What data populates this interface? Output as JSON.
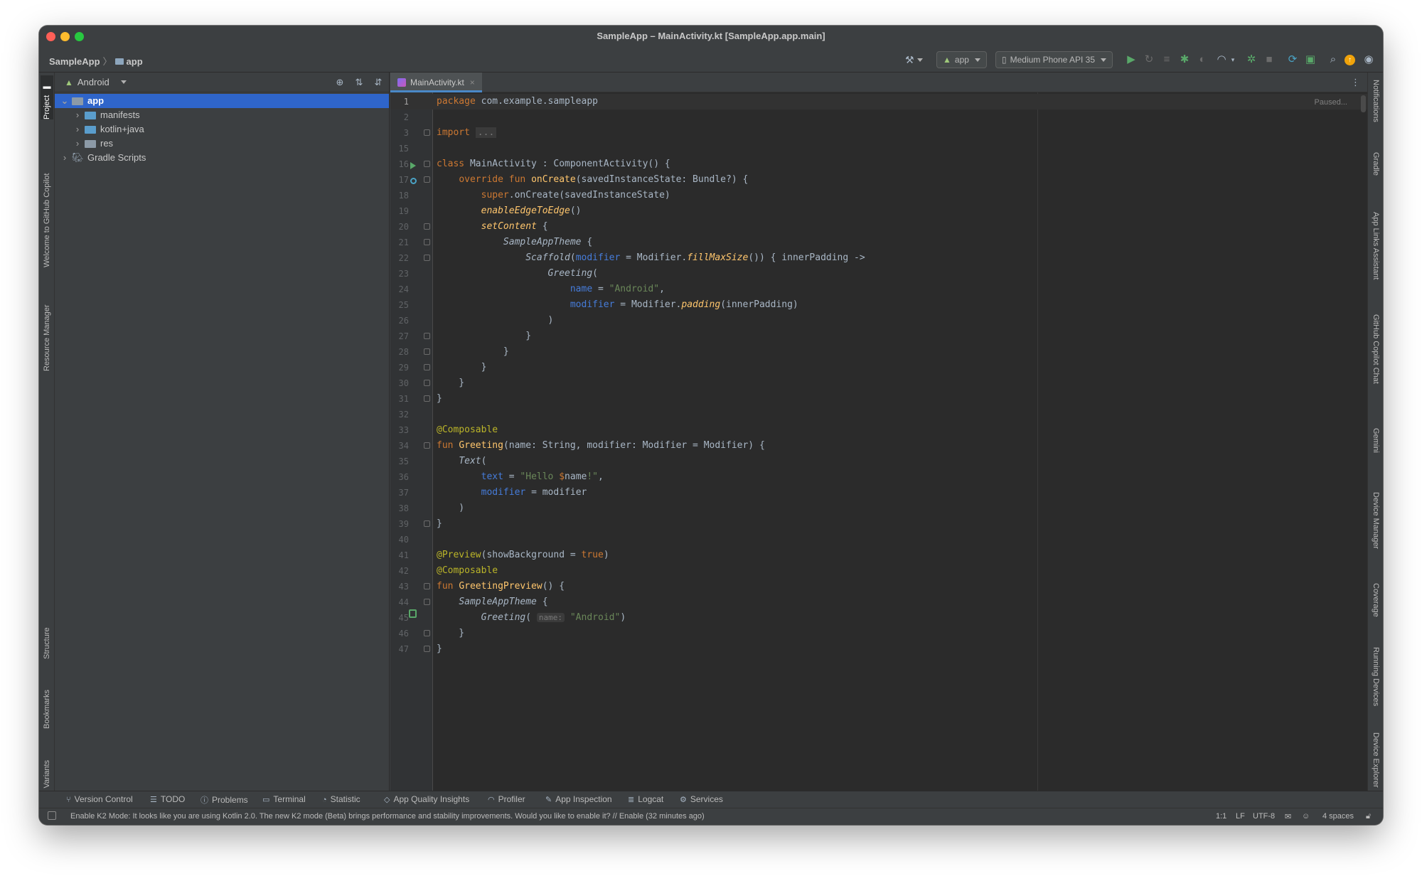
{
  "window": {
    "title": "SampleApp – MainActivity.kt [SampleApp.app.main]"
  },
  "navbar": {
    "project": "SampleApp",
    "module": "app",
    "run_config": "app",
    "device": "Medium Phone API 35"
  },
  "left_stripe": {
    "project": "Project",
    "copilot_welcome": "Welcome to GitHub Copilot",
    "resource_manager": "Resource Manager",
    "structure": "Structure",
    "bookmarks": "Bookmarks",
    "build_variants": "Build Variants"
  },
  "right_stripe": {
    "notifications": "Notifications",
    "gradle": "Gradle",
    "app_links": "App Links Assistant",
    "copilot_chat": "GitHub Copilot Chat",
    "gemini": "Gemini",
    "device_manager": "Device Manager",
    "coverage": "Coverage",
    "running_devices": "Running Devices",
    "device_explorer": "Device Explorer"
  },
  "project_panel": {
    "view": "Android",
    "tree": [
      {
        "label": "app",
        "selected": true,
        "depth": 0,
        "expanded": true,
        "icon": "module-folder-icon"
      },
      {
        "label": "manifests",
        "selected": false,
        "depth": 1,
        "expanded": false,
        "icon": "folder-icon"
      },
      {
        "label": "kotlin+java",
        "selected": false,
        "depth": 1,
        "expanded": false,
        "icon": "folder-icon"
      },
      {
        "label": "res",
        "selected": false,
        "depth": 1,
        "expanded": false,
        "icon": "res-folder-icon"
      },
      {
        "label": "Gradle Scripts",
        "selected": false,
        "depth": 0,
        "expanded": false,
        "icon": "gradle-icon"
      }
    ]
  },
  "editor": {
    "tab": "MainActivity.kt",
    "paused_label": "Paused...",
    "lines": [
      {
        "n": "1",
        "html": "<span class='kw'>package</span> com.example.sampleapp"
      },
      {
        "n": "2",
        "html": ""
      },
      {
        "n": "3",
        "html": "<span class='kw'>import</span> <span class='fold-box'>...</span>"
      },
      {
        "n": "15",
        "html": ""
      },
      {
        "n": "16",
        "html": "<span class='kw'>class</span> MainActivity : ComponentActivity() {"
      },
      {
        "n": "17",
        "html": "    <span class='kw'>override fun</span> <span class='fn'>onCreate</span>(savedInstanceState: Bundle?) {"
      },
      {
        "n": "18",
        "html": "        <span class='kw'>super</span>.onCreate(savedInstanceState)"
      },
      {
        "n": "19",
        "html": "        <span class='fni'>enableEdgeToEdge</span>()"
      },
      {
        "n": "20",
        "html": "        <span class='fni'>setContent</span> {"
      },
      {
        "n": "21",
        "html": "            <span class='it'>SampleAppTheme</span> {"
      },
      {
        "n": "22",
        "html": "                <span class='it'>Scaffold</span>(<span class='pn'>modifier</span> = Modifier.<span class='fni'>fillMaxSize</span>()) { innerPadding ->"
      },
      {
        "n": "23",
        "html": "                    <span class='it'>Greeting</span>("
      },
      {
        "n": "24",
        "html": "                        <span class='pn'>name</span> = <span class='str'>\"Android\"</span>,"
      },
      {
        "n": "25",
        "html": "                        <span class='pn'>modifier</span> = Modifier.<span class='fni'>padding</span>(innerPadding)"
      },
      {
        "n": "26",
        "html": "                    )"
      },
      {
        "n": "27",
        "html": "                }"
      },
      {
        "n": "28",
        "html": "            }"
      },
      {
        "n": "29",
        "html": "        }"
      },
      {
        "n": "30",
        "html": "    }"
      },
      {
        "n": "31",
        "html": "}"
      },
      {
        "n": "32",
        "html": ""
      },
      {
        "n": "33",
        "html": "<span class='ann'>@Composable</span>"
      },
      {
        "n": "34",
        "html": "<span class='kw'>fun</span> <span class='fn'>Greeting</span>(name: String, modifier: Modifier = Modifier) {"
      },
      {
        "n": "35",
        "html": "    <span class='it'>Text</span>("
      },
      {
        "n": "36",
        "html": "        <span class='pn'>text</span> = <span class='str'>\"Hello </span><span class='kw'>$</span>name<span class='str'>!\"</span>,"
      },
      {
        "n": "37",
        "html": "        <span class='pn'>modifier</span> = modifier"
      },
      {
        "n": "38",
        "html": "    )"
      },
      {
        "n": "39",
        "html": "}"
      },
      {
        "n": "40",
        "html": ""
      },
      {
        "n": "41",
        "html": "<span class='ann'>@Preview</span>(showBackground = <span class='kw'>true</span>)"
      },
      {
        "n": "42",
        "html": "<span class='ann'>@Composable</span>"
      },
      {
        "n": "43",
        "html": "<span class='kw'>fun</span> <span class='fn'>GreetingPreview</span>() {"
      },
      {
        "n": "44",
        "html": "    <span class='it'>SampleAppTheme</span> {"
      },
      {
        "n": "45",
        "html": "        <span class='it'>Greeting</span>( <span class='hint'>name:</span> <span class='str'>\"Android\"</span>)"
      },
      {
        "n": "46",
        "html": "    }"
      },
      {
        "n": "47",
        "html": "}"
      }
    ]
  },
  "bottom_tabs": {
    "version_control": "Version Control",
    "todo": "TODO",
    "problems": "Problems",
    "terminal": "Terminal",
    "statistic": "Statistic",
    "app_quality": "App Quality Insights",
    "profiler": "Profiler",
    "app_inspection": "App Inspection",
    "logcat": "Logcat",
    "services": "Services"
  },
  "statusbar": {
    "message": "Enable K2 Mode: It looks like you are using Kotlin 2.0. The new K2 mode (Beta) brings performance and stability improvements. Would you like to enable it? // Enable (32 minutes ago)",
    "position": "1:1",
    "line_sep": "LF",
    "encoding": "UTF-8",
    "indent": "4 spaces"
  }
}
